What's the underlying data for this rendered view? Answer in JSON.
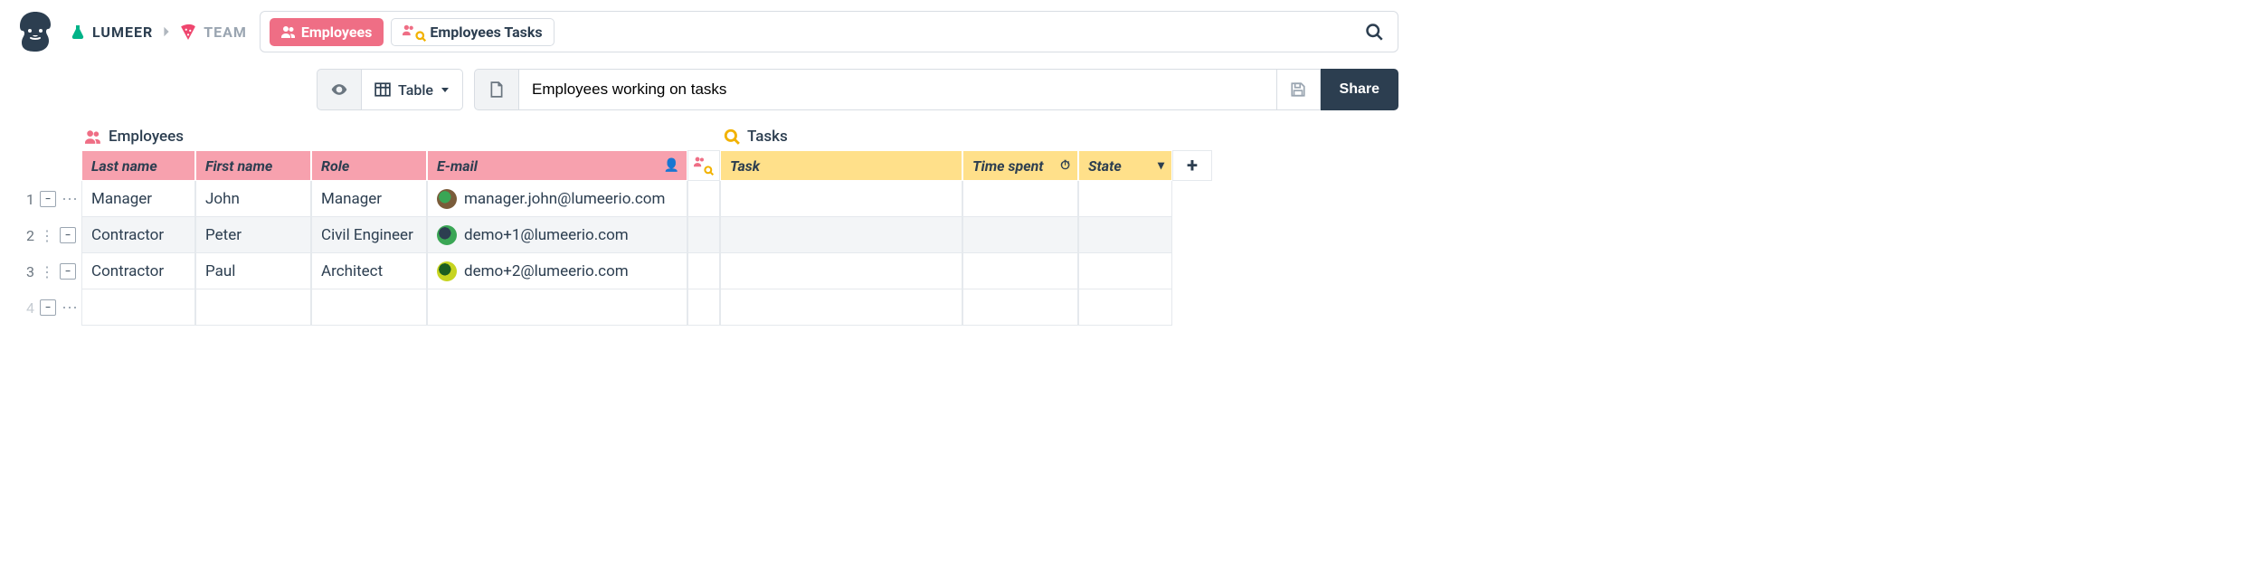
{
  "breadcrumb": {
    "org": "LUMEER",
    "team": "TEAM"
  },
  "chips": {
    "employees": "Employees",
    "emp_tasks": "Employees Tasks"
  },
  "toolbar": {
    "view_label": "Table",
    "name_value": "Employees working on tasks",
    "share_label": "Share"
  },
  "table_titles": {
    "employees": "Employees",
    "tasks": "Tasks"
  },
  "emp_columns": {
    "last_name": "Last name",
    "first_name": "First name",
    "role": "Role",
    "email": "E-mail"
  },
  "task_columns": {
    "task": "Task",
    "time_spent": "Time spent",
    "state": "State"
  },
  "rows": [
    {
      "n": "1",
      "last": "Manager",
      "first": "John",
      "role": "Manager",
      "email": "manager.john@lumeerio.com",
      "avatar_bg": "#7a5c3a",
      "avatar_fg": "#3aa655"
    },
    {
      "n": "2",
      "last": "Contractor",
      "first": "Peter",
      "role": "Civil Engineer",
      "email": "demo+1@lumeerio.com",
      "avatar_bg": "#3aa655",
      "avatar_fg": "#2c3e50"
    },
    {
      "n": "3",
      "last": "Contractor",
      "first": "Paul",
      "role": "Architect",
      "email": "demo+2@lumeerio.com",
      "avatar_bg": "#c6d420",
      "avatar_fg": "#1b5e20"
    }
  ],
  "blank_row_n": "4"
}
